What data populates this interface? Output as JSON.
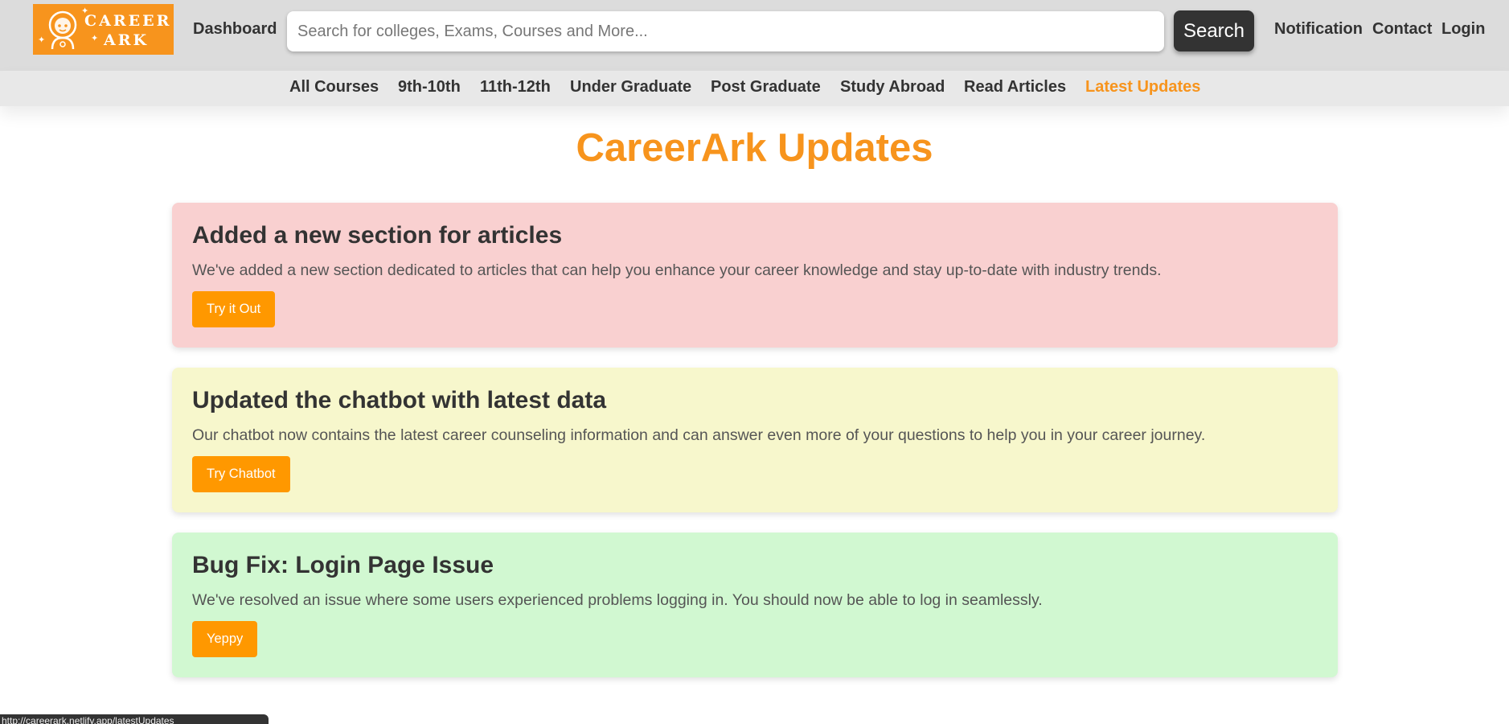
{
  "header": {
    "logo_line1": "CAREER",
    "logo_line2": "ARK",
    "dashboard_label": "Dashboard",
    "search_placeholder": "Search for colleges, Exams, Courses and More...",
    "search_button": "Search",
    "notification_label": "Notification",
    "contact_label": "Contact",
    "login_label": "Login"
  },
  "subnav": {
    "items": [
      {
        "label": "All Courses"
      },
      {
        "label": "9th-10th"
      },
      {
        "label": "11th-12th"
      },
      {
        "label": "Under Graduate"
      },
      {
        "label": "Post Graduate"
      },
      {
        "label": "Study Abroad"
      },
      {
        "label": "Read Articles"
      },
      {
        "label": "Latest Updates"
      }
    ],
    "active": "Latest Updates"
  },
  "main": {
    "title": "CareerArk Updates",
    "cards": [
      {
        "title": "Added a new section for articles",
        "text": "We've added a new section dedicated to articles that can help you enhance your career knowledge and stay up-to-date with industry trends.",
        "button": "Try it Out",
        "bg": "#f9d0d0"
      },
      {
        "title": "Updated the chatbot with latest data",
        "text": "Our chatbot now contains the latest career counseling information and can answer even more of your questions to help you in your career journey.",
        "button": "Try Chatbot",
        "bg": "#f7f7cc"
      },
      {
        "title": "Bug Fix: Login Page Issue",
        "text": "We've resolved an issue where some users experienced problems logging in. You should now be able to log in seamlessly.",
        "button": "Yeppy",
        "bg": "#d1f8d1"
      }
    ]
  },
  "status_bar": {
    "url": "http://careerark.netlify.app/latestUpdates"
  },
  "colors": {
    "accent": "#f7941d",
    "button": "#ff9800",
    "dark": "#333333"
  }
}
